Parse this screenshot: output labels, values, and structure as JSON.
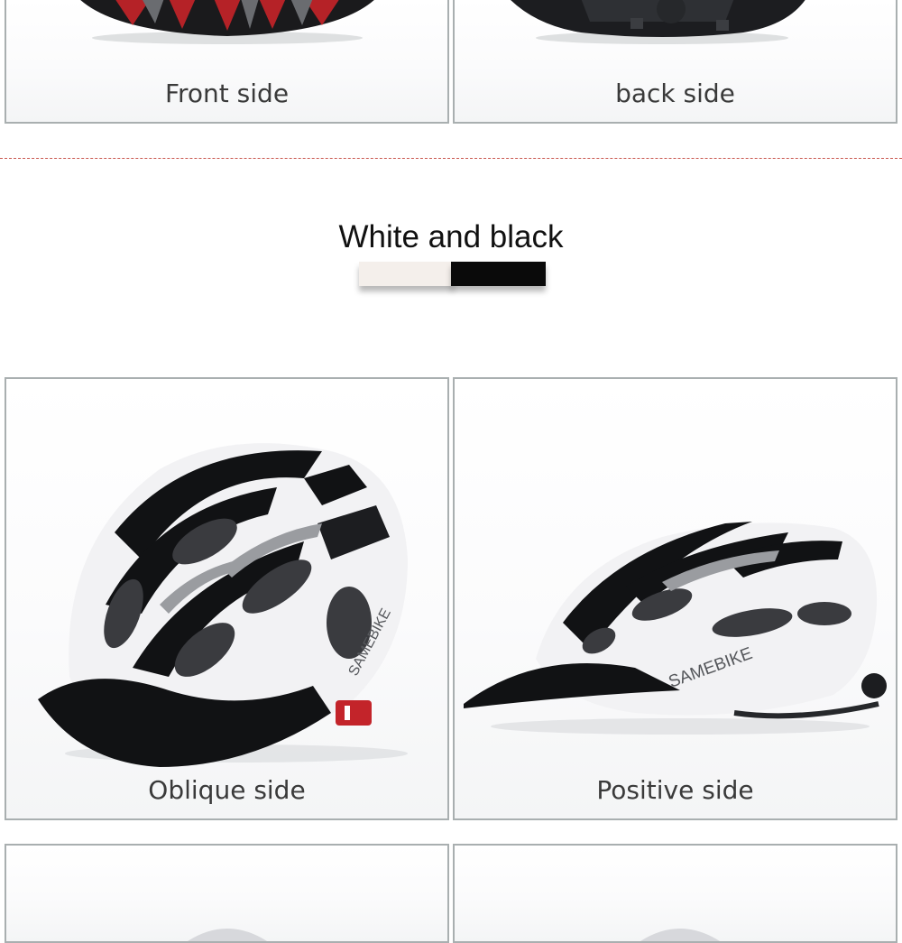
{
  "top_row": {
    "left_caption": "Front side",
    "right_caption": "back side"
  },
  "color_section": {
    "title": "White and black",
    "swatches": [
      {
        "color": "#f4efeb"
      },
      {
        "color": "#0a0a0a"
      }
    ]
  },
  "middle_row": {
    "left_caption": "Oblique side",
    "right_caption": "Positive side",
    "brand_text": "SAMEBIKE"
  },
  "colors": {
    "panel_border": "#a9afb0",
    "divider": "#c9574f",
    "helmet_shell": "#f2f2f4",
    "helmet_dark": "#111214",
    "accent_red": "#c3242a"
  }
}
